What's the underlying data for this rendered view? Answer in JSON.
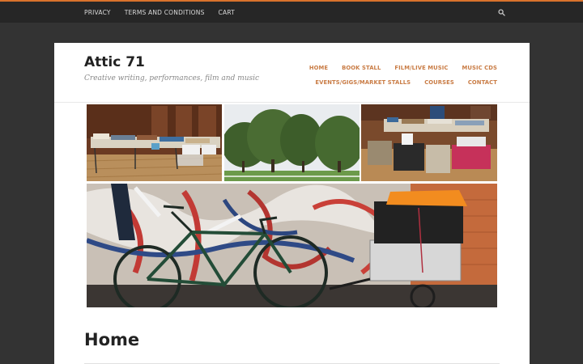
{
  "topbar": {
    "links": [
      "PRIVACY",
      "TERMS AND CONDITIONS",
      "CART"
    ],
    "search_icon": "search-icon",
    "accent_color": "#d9722c"
  },
  "site": {
    "title": "Attic 71",
    "tagline": "Creative writing, performances, film and music"
  },
  "nav": {
    "row1": [
      "HOME",
      "BOOK STALL",
      "FILM/LIVE MUSIC",
      "MUSIC CDS"
    ],
    "row2": [
      "EVENTS/GIGS/MARKET STALLS",
      "COURSES",
      "CONTACT"
    ],
    "link_color": "#c97c45"
  },
  "photos": [
    "book-stall-photo",
    "trees-park-photo",
    "book-stall-photo-2",
    "bicycle-trailer-graffiti-photo"
  ],
  "page": {
    "heading": "Home"
  }
}
